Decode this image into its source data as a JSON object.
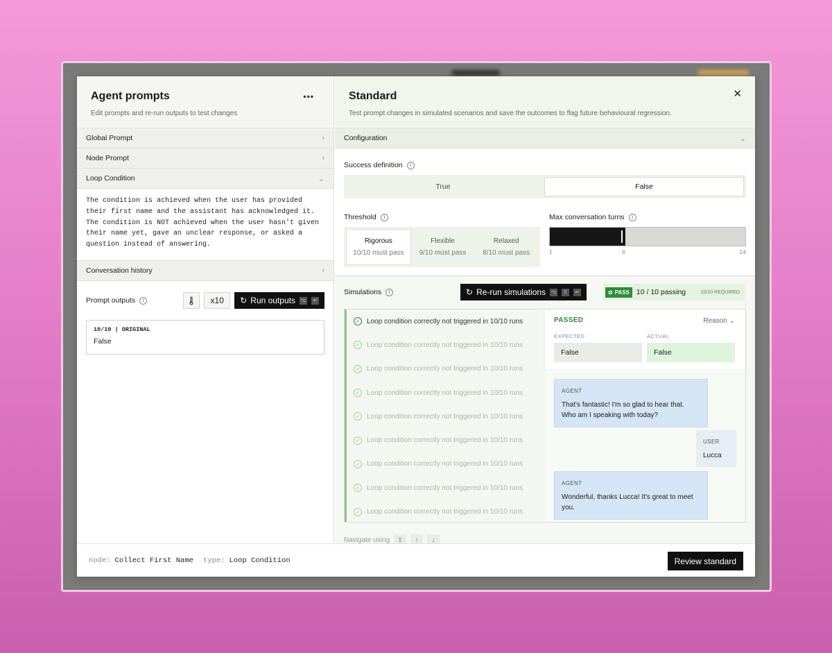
{
  "left": {
    "title": "Agent prompts",
    "subtitle": "Edit prompts and re-run outputs to test changes",
    "menu_icon": "more-dots-icon",
    "sections": [
      {
        "label": "Global Prompt",
        "icon": "chevron-right-icon"
      },
      {
        "label": "Node Prompt",
        "icon": "chevron-right-icon"
      },
      {
        "label": "Loop Condition",
        "icon": "chevron-down-icon"
      }
    ],
    "condition_text": "The condition is achieved when the user has provided\ntheir first name and the assistant has acknowledged it.\nThe condition is NOT achieved when the user hasn't given\ntheir name yet, gave an unclear response, or asked a\nquestion instead of answering.",
    "conversation_history": "Conversation history",
    "prompt_outputs_label": "Prompt outputs",
    "multiplier": "x10",
    "run_outputs": "Run outputs",
    "output": {
      "header": "10/10 | ORIGINAL",
      "value": "False"
    },
    "footer": {
      "node_key": "node:",
      "node_val": "Collect First Name",
      "type_key": "type:",
      "type_val": "Loop Condition"
    }
  },
  "right": {
    "title": "Standard",
    "subtitle": "Test prompt changes in simulated scenarios and save the outcomes to flag future behavioural regression.",
    "close": "✕",
    "configuration": "Configuration",
    "success_definition": "Success definition",
    "success_options": [
      "True",
      "False"
    ],
    "success_selected": "False",
    "threshold_label": "Threshold",
    "threshold_options": [
      {
        "name": "Rigorous",
        "desc": "10/10 must pass"
      },
      {
        "name": "Flexible",
        "desc": "9/10 must pass"
      },
      {
        "name": "Relaxed",
        "desc": "8/10 must pass"
      }
    ],
    "max_turns_label": "Max conversation turns",
    "max_turns": {
      "min": "1",
      "value": "6",
      "max": "14",
      "fill_fraction": 0.385
    },
    "simulations_label": "Simulations",
    "rerun": "Re-run simulations",
    "pass_badge": "PASS",
    "passing": "10 / 10 passing",
    "required": "10/10 REQUIRED",
    "sim_items": [
      "Loop condition correctly not triggered in 10/10 runs",
      "Loop condition correctly not triggered in 10/10 runs",
      "Loop condition correctly not triggered in 10/10 runs",
      "Loop condition correctly not triggered in 10/10 runs",
      "Loop condition correctly not triggered in 10/10 runs",
      "Loop condition correctly not triggered in 10/10 runs",
      "Loop condition correctly not triggered in 10/10 runs",
      "Loop condition correctly not triggered in 10/10 runs",
      "Loop condition correctly not triggered in 10/10 runs"
    ],
    "detail": {
      "status": "PASSED",
      "reason": "Reason ⌄",
      "expected_label": "EXPECTED",
      "actual_label": "ACTUAL",
      "expected": "False",
      "actual": "False",
      "messages": [
        {
          "who": "AGENT",
          "text": "That's fantastic! I'm so glad to hear that. Who am I speaking with today?"
        },
        {
          "who": "USER",
          "text": "Lucca"
        },
        {
          "who": "AGENT",
          "text": "Wonderful, thanks Lucca! It's great to meet you."
        }
      ]
    },
    "navigate": "Navigate using",
    "nav_keys": [
      "⇧",
      "↑",
      "↓"
    ],
    "review": "Review standard"
  },
  "colors": {
    "pass_green": "#2f8a3b",
    "accent_dark": "#111111",
    "agent_bubble": "#d6e5f5"
  }
}
